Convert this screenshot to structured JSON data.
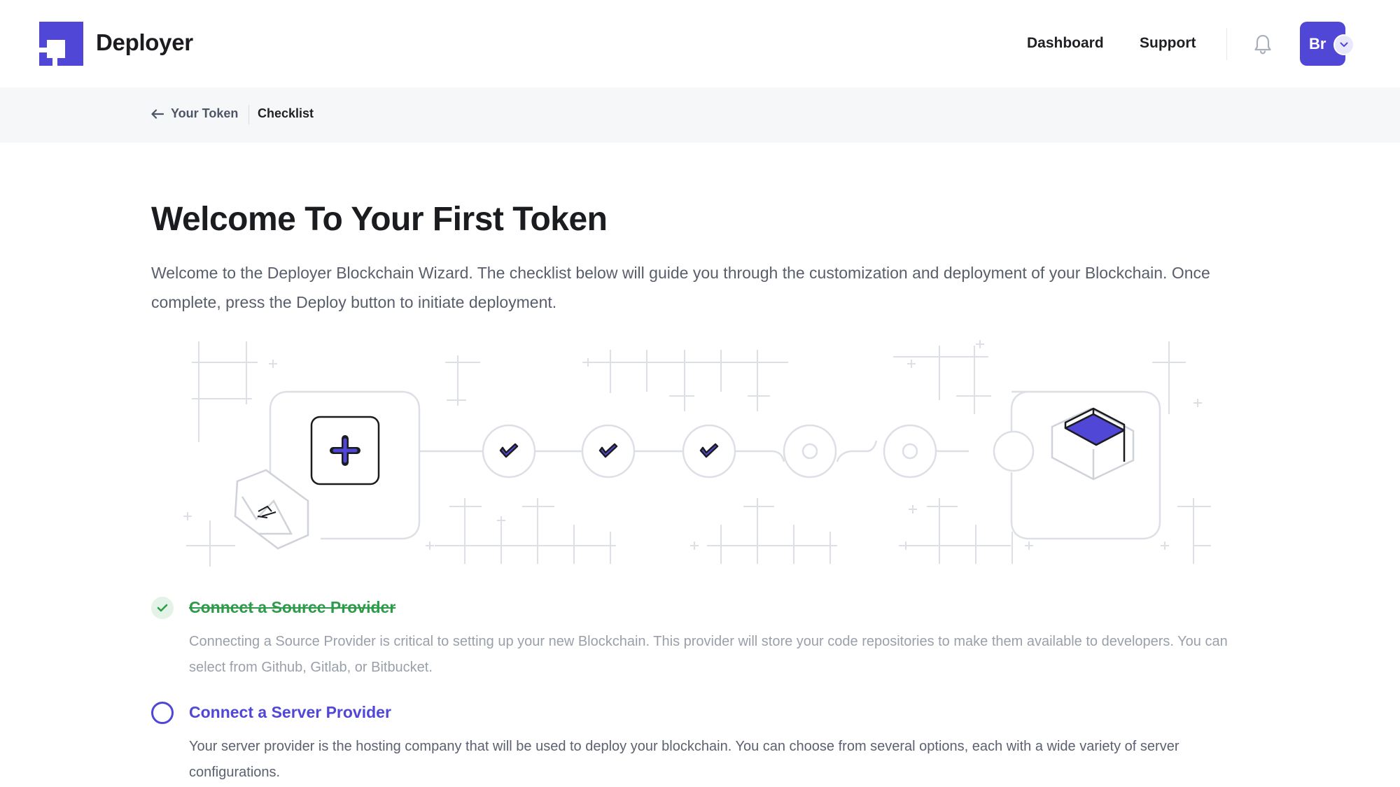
{
  "header": {
    "brand": "Deployer",
    "nav": [
      {
        "label": "Dashboard"
      },
      {
        "label": "Support"
      }
    ],
    "avatar_initials": "Br"
  },
  "breadcrumb": {
    "back_label": "Your Token",
    "current": "Checklist"
  },
  "main": {
    "title": "Welcome To Your First Token",
    "intro": "Welcome to the Deployer Blockchain Wizard. The checklist below will guide you through the customization and deployment of your Blockchain. Once complete, press the Deploy button to initiate deployment."
  },
  "checklist": [
    {
      "title": "Connect a Source Provider",
      "description": "Connecting a Source Provider is critical to setting up your new Blockchain. This provider will store your code repositories to make them available to developers. You can select from Github, Gitlab, or Bitbucket.",
      "status": "complete"
    },
    {
      "title": "Connect a Server Provider",
      "description": "Your server provider is the hosting company that will be used to deploy your blockchain. You can choose from several options, each with a wide variety of server configurations.",
      "status": "pending"
    }
  ],
  "colors": {
    "accent": "#5147d6",
    "success": "#2e9b4a",
    "text": "#1b1c20",
    "muted": "#585e6b",
    "breadcrumb_bg": "#f5f7f8"
  },
  "icons": {
    "logo": "deployer-logo",
    "back": "arrow-left-icon",
    "notifications": "bell-icon",
    "avatar_menu": "chevron-down-icon",
    "step_done": "checkmark-icon",
    "start": "plus-icon",
    "end": "cube-icon"
  }
}
